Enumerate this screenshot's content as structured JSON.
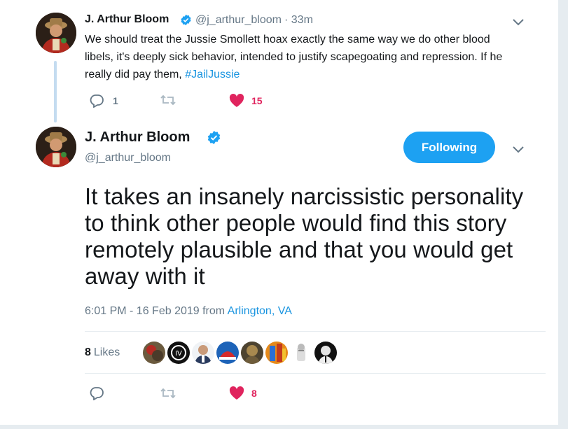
{
  "reply_tweet": {
    "name": "J. Arthur Bloom",
    "handle": "@j_arthur_bloom",
    "time": "· 33m",
    "text_before": "We should treat the Jussie Smollett hoax exactly the same way we do other blood libels, it's deeply sick behavior, intended to justify scapegoating and repression. If he really did pay them, ",
    "hashtag": "#JailJussie",
    "reply_count": "1",
    "like_count": "15"
  },
  "main_tweet": {
    "name": "J. Arthur Bloom",
    "handle": "@j_arthur_bloom",
    "follow_label": "Following",
    "text": "It takes an insanely narcissistic personality to think other people would find this story remotely plausible and that you would get away with it",
    "timestamp": "6:01 PM - 16 Feb 2019 from ",
    "location": "Arlington, VA",
    "likes_count": "8",
    "likes_label": "Likes",
    "bottom_like_count": "8"
  },
  "colors": {
    "accent": "#1da1f2",
    "link": "#1b95e0",
    "like": "#e0245e",
    "muted": "#657786"
  }
}
